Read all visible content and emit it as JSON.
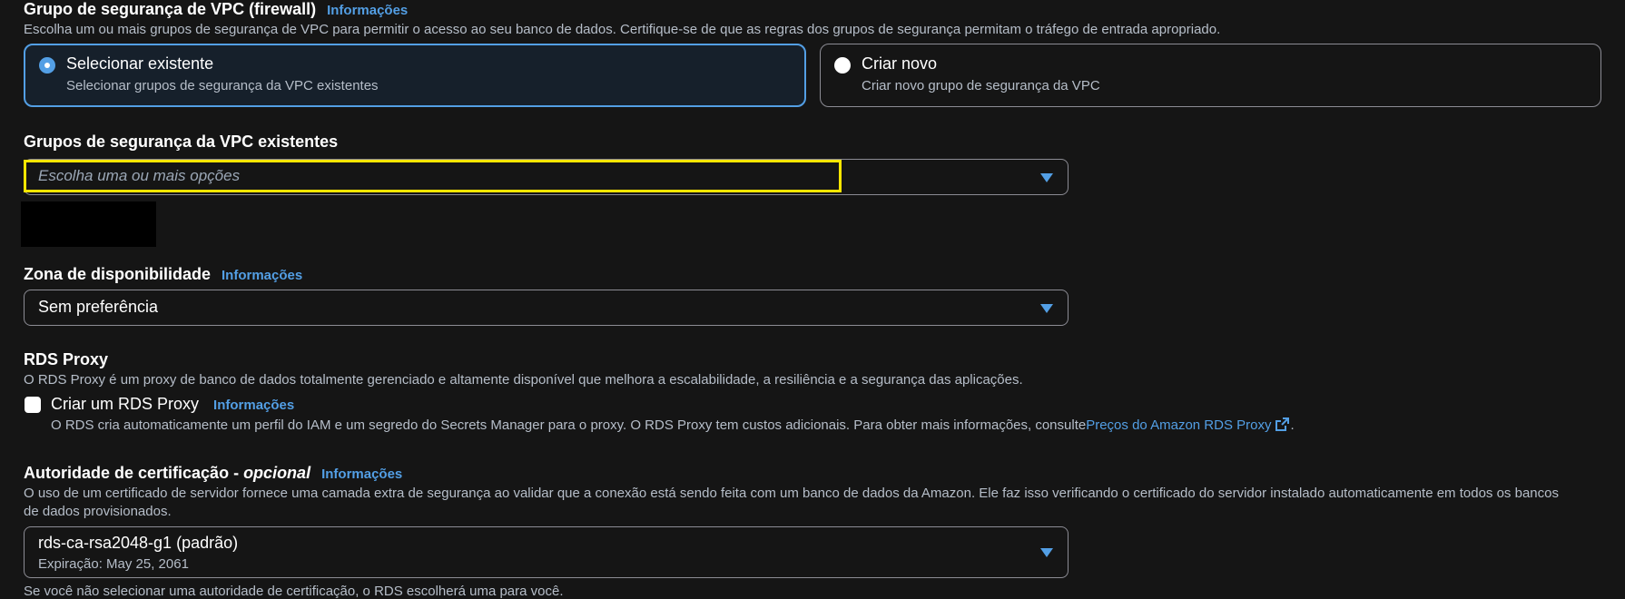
{
  "vpc_sg": {
    "title": "Grupo de segurança de VPC (firewall)",
    "info": "Informações",
    "description": "Escolha um ou mais grupos de segurança de VPC para permitir o acesso ao seu banco de dados. Certifique-se de que as regras dos grupos de segurança permitam o tráfego de entrada apropriado.",
    "options": [
      {
        "title": "Selecionar existente",
        "description": "Selecionar grupos de segurança da VPC existentes",
        "selected": true
      },
      {
        "title": "Criar novo",
        "description": "Criar novo grupo de segurança da VPC",
        "selected": false
      }
    ]
  },
  "existing_sg": {
    "label": "Grupos de segurança da VPC existentes",
    "placeholder": "Escolha uma ou mais opções"
  },
  "az": {
    "label": "Zona de disponibilidade",
    "info": "Informações",
    "value": "Sem preferência"
  },
  "rds_proxy": {
    "title": "RDS Proxy",
    "description": "O RDS Proxy é um proxy de banco de dados totalmente gerenciado e altamente disponível que melhora a escalabilidade, a resiliência e a segurança das aplicações.",
    "checkbox_label": "Criar um RDS Proxy",
    "info": "Informações",
    "checkbox_desc": "O RDS cria automaticamente um perfil do IAM e um segredo do Secrets Manager para o proxy. O RDS Proxy tem custos adicionais. Para obter mais informações, consulte",
    "link": "Preços do Amazon RDS Proxy",
    "trailing": "."
  },
  "ca": {
    "title": "Autoridade de certificação - ",
    "optional": "opcional",
    "info": "Informações",
    "description_1": "O uso de um certificado de servidor fornece uma camada extra de segurança ao validar que a conexão está sendo feita com um banco de dados da Amazon. Ele faz isso verificando o certificado do servidor instalado automaticamente em todos os bancos",
    "description_2": "de dados provisionados.",
    "value": "rds-ca-rsa2048-g1 (padrão)",
    "expiration": "Expiração: May 25, 2061",
    "footer": "Se você não selecionar uma autoridade de certificação, o RDS escolherá uma para você."
  },
  "colors": {
    "accent": "#539fe5",
    "highlight": "#ffe600",
    "background": "#151515"
  }
}
